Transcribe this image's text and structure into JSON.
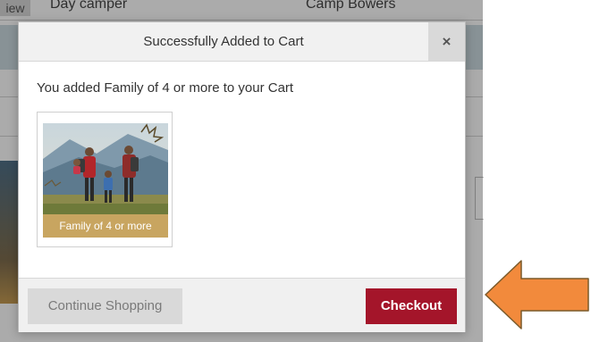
{
  "background": {
    "tab_label": "iew",
    "row1_col1": "Day camper",
    "row1_col2": "Camp Bowers"
  },
  "modal": {
    "title": "Successfully Added to Cart",
    "close_label": "×",
    "message": "You added Family of 4 or more to your Cart",
    "product": {
      "caption": "Family of 4 or more"
    },
    "continue_label": "Continue Shopping",
    "checkout_label": "Checkout"
  },
  "colors": {
    "checkout": "#a4152a",
    "caption_bg": "#c8a560",
    "arrow": "#f28a3c"
  },
  "icons": {
    "close": "close-icon",
    "annotation": "arrow-left-icon"
  }
}
